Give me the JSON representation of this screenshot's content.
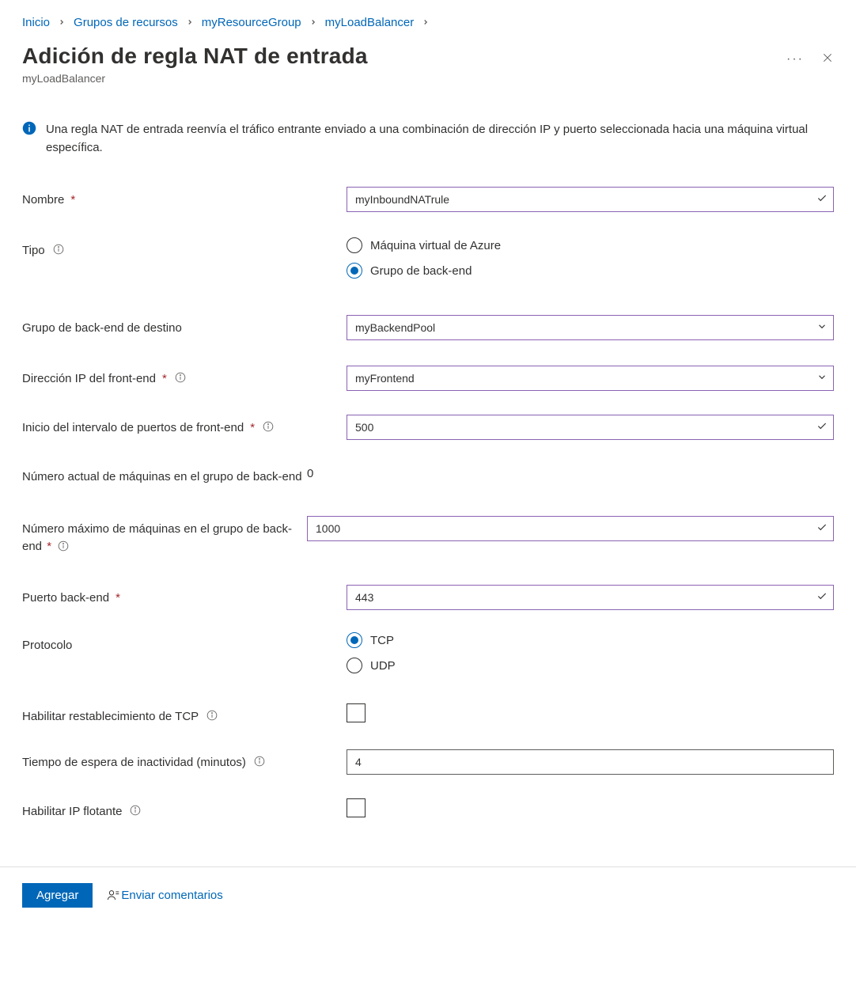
{
  "breadcrumb": {
    "items": [
      "Inicio",
      "Grupos de recursos",
      "myResourceGroup",
      "myLoadBalancer"
    ]
  },
  "header": {
    "title": "Adición de regla NAT de entrada",
    "subtitle": "myLoadBalancer"
  },
  "info": {
    "text": "Una regla NAT de entrada reenvía el tráfico entrante enviado a una combinación de dirección IP y puerto seleccionada hacia una máquina virtual específica."
  },
  "form": {
    "name": {
      "label": "Nombre",
      "value": "myInboundNATrule"
    },
    "type": {
      "label": "Tipo",
      "options": [
        "Máquina virtual de Azure",
        "Grupo de back-end"
      ],
      "selected": 1
    },
    "backend_group": {
      "label": "Grupo de back-end de destino",
      "value": "myBackendPool"
    },
    "frontend_ip": {
      "label": "Dirección IP del front-end",
      "value": "myFrontend"
    },
    "port_start": {
      "label": "Inicio del intervalo de puertos de front-end",
      "value": "500"
    },
    "current_machines": {
      "label": "Número actual de máquinas en el grupo de back-end",
      "value": "0"
    },
    "max_machines": {
      "label": "Número máximo de máquinas en el grupo de back-end",
      "value": "1000"
    },
    "backend_port": {
      "label": "Puerto back-end",
      "value": "443"
    },
    "protocol": {
      "label": "Protocolo",
      "options": [
        "TCP",
        "UDP"
      ],
      "selected": 0
    },
    "tcp_reset": {
      "label": "Habilitar restablecimiento de TCP",
      "checked": false
    },
    "idle_timeout": {
      "label": "Tiempo de espera de inactividad (minutos)",
      "value": "4"
    },
    "floating_ip": {
      "label": "Habilitar IP flotante",
      "checked": false
    }
  },
  "footer": {
    "add": "Agregar",
    "feedback": "Enviar comentarios"
  }
}
